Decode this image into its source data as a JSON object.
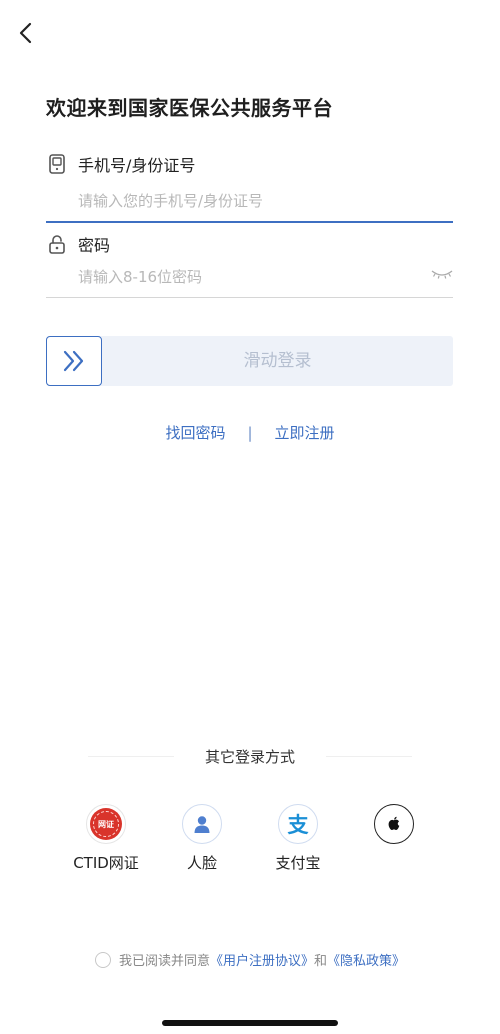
{
  "header": {
    "title": "欢迎来到国家医保公共服务平台"
  },
  "phone": {
    "label": "手机号/身份证号",
    "placeholder": "请输入您的手机号/身份证号"
  },
  "password": {
    "label": "密码",
    "placeholder": "请输入8-16位密码"
  },
  "slider": {
    "text": "滑动登录"
  },
  "links": {
    "recover": "找回密码",
    "separator": "|",
    "register": "立即注册"
  },
  "other_login": {
    "title": "其它登录方式",
    "options": [
      {
        "label": "CTID网证",
        "icon": "ctid-seal-icon",
        "badge": "网证"
      },
      {
        "label": "人脸",
        "icon": "face-icon"
      },
      {
        "label": "支付宝",
        "icon": "alipay-icon",
        "glyph": "支"
      },
      {
        "label": "",
        "icon": "apple-icon"
      }
    ]
  },
  "agreement": {
    "prefix": "我已阅读并同意",
    "user_agreement": "《用户注册协议》",
    "and": "和",
    "privacy": "《隐私政策》"
  },
  "colors": {
    "accent": "#3d6fc2",
    "ctid_red": "#d9342b",
    "slider_bg": "#eef2f9"
  }
}
